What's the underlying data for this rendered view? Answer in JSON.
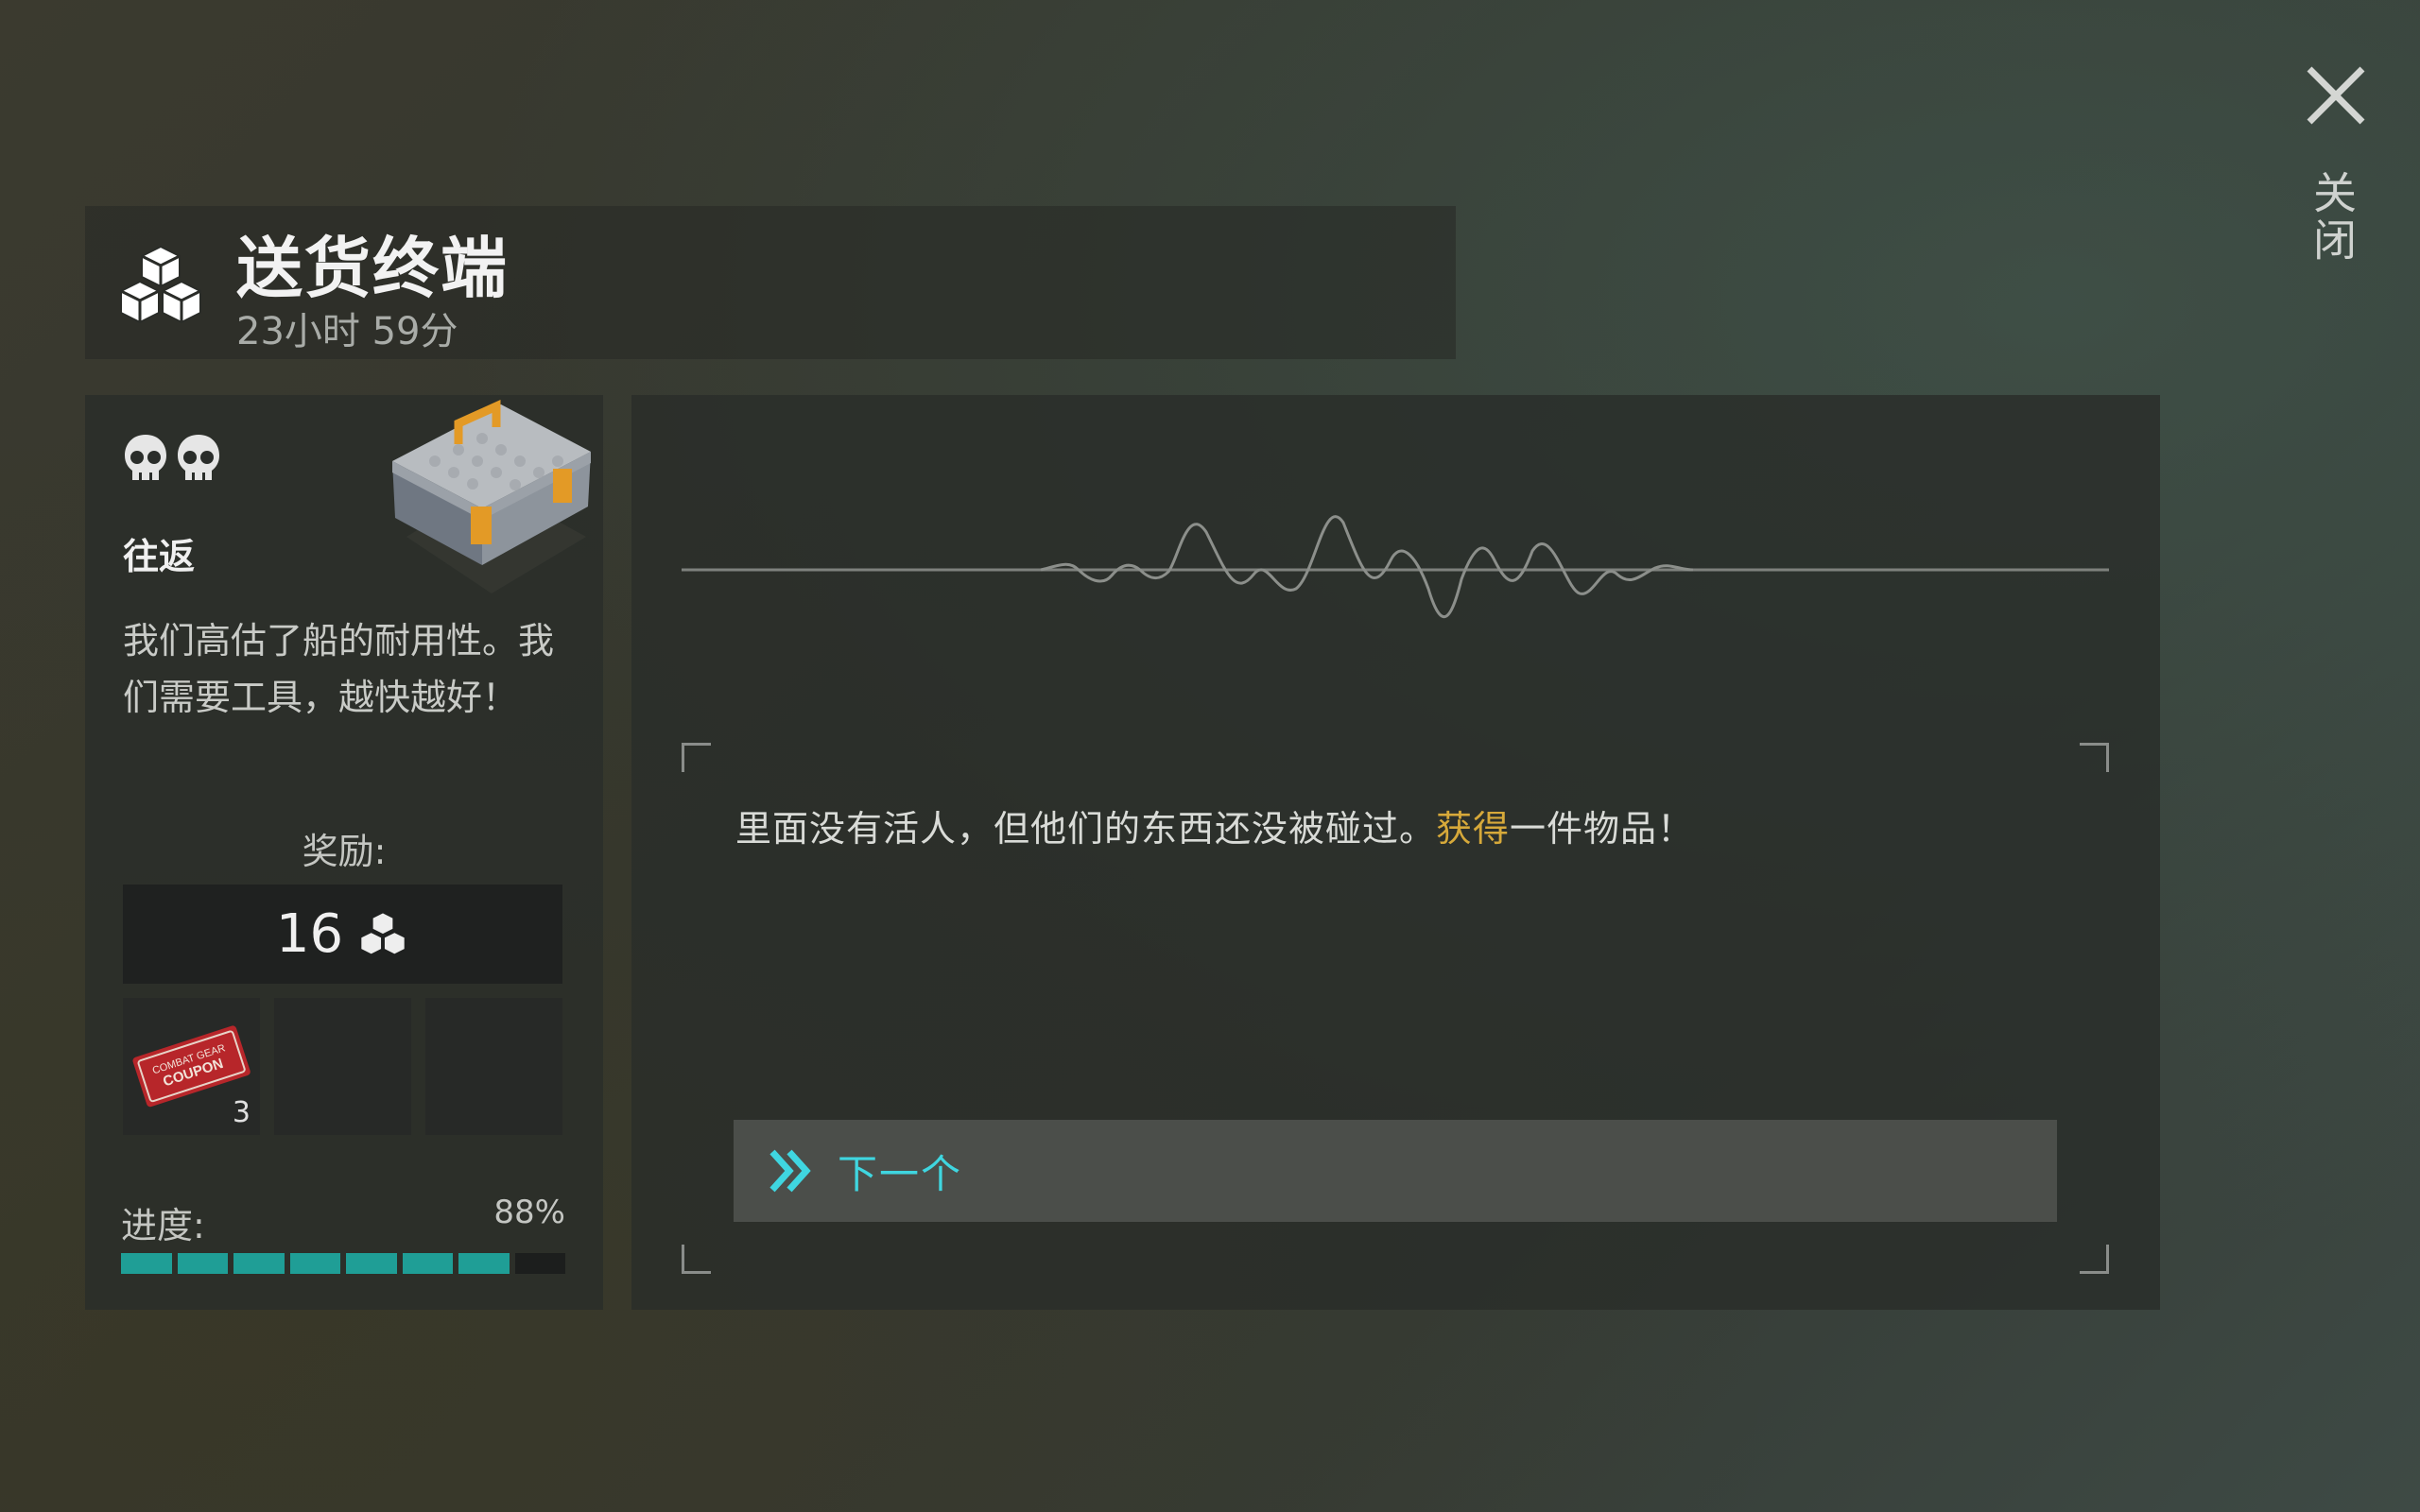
{
  "window": {
    "close_label": "关闭"
  },
  "header": {
    "title": "送货终端",
    "timer": "23小时 59分",
    "icon": "boxes-icon"
  },
  "mission": {
    "difficulty_icons": [
      "skull-icon",
      "skull-icon"
    ],
    "route": "往返",
    "description": "我们高估了船的耐用性。我们需要工具，越快越好！",
    "reward_label": "奖励:",
    "reward_value": "16",
    "reward_icon": "boxes-icon",
    "reward_items": [
      {
        "name": "combat-gear-coupon",
        "icon_text": "COMBAT GEAR COUPON",
        "count": "3"
      }
    ],
    "progress_label": "进度:",
    "progress_text": "88%",
    "progress_fraction": 0.88,
    "progress_segments_total": 8,
    "progress_segments_filled": 7
  },
  "dialog": {
    "message_before": "里面没有活人，但他们的东西还没被碰过。",
    "message_highlight": "获得",
    "message_after": "一件物品！",
    "next_label": "下一个"
  },
  "colors": {
    "accent_teal": "#1f9e96",
    "highlight": "#d7a93a",
    "next_text": "#3fd6e0"
  }
}
